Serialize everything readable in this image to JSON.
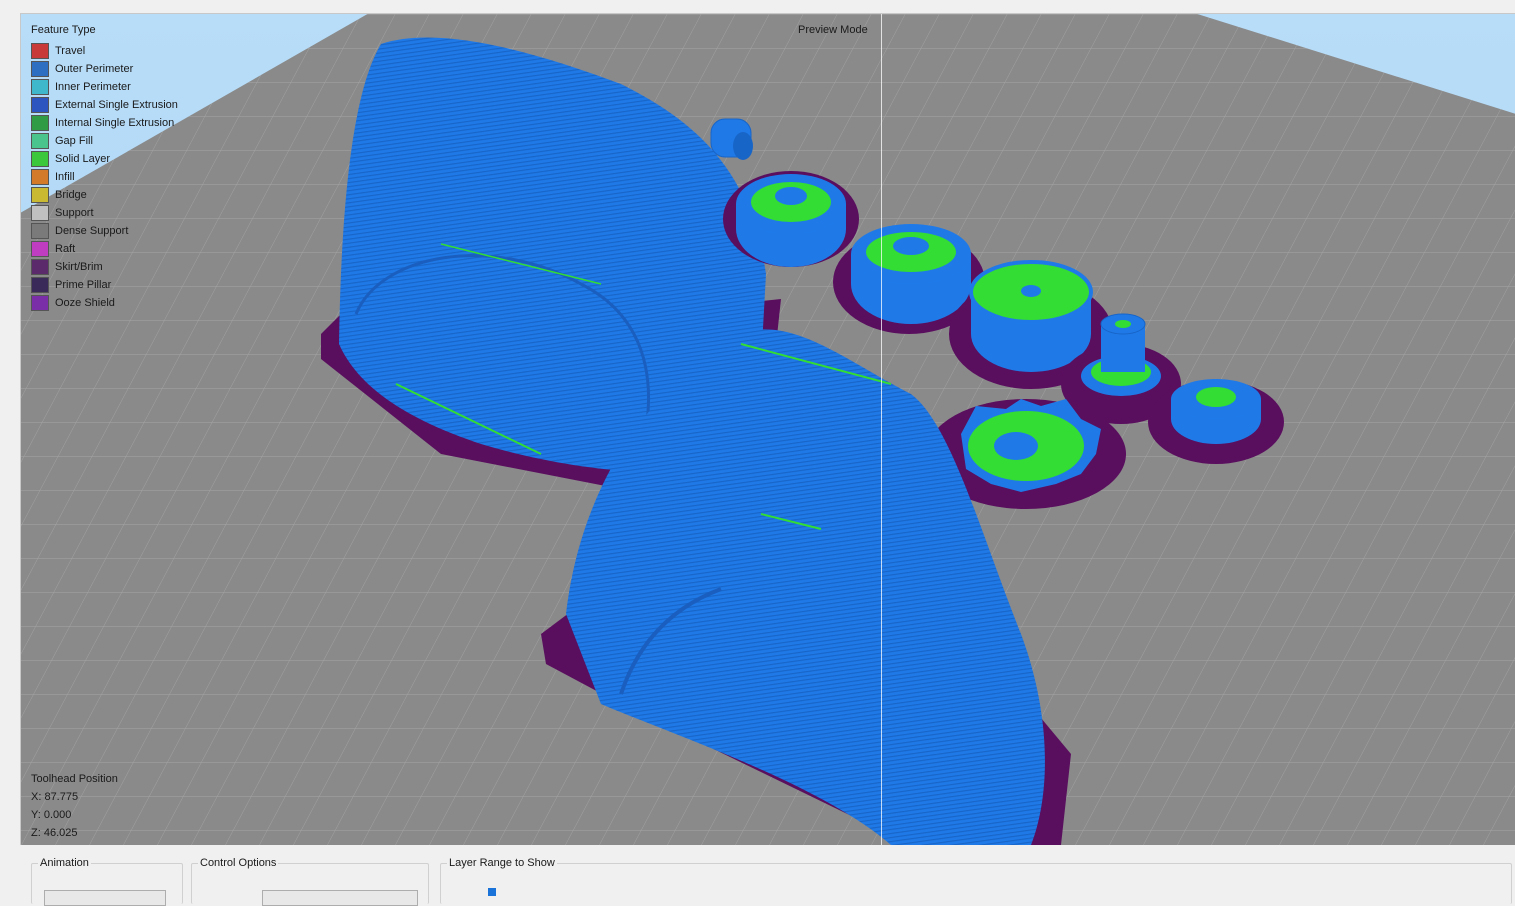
{
  "viewport": {
    "mode_label": "Preview Mode",
    "legend": {
      "title": "Feature Type",
      "items": [
        {
          "label": "Travel",
          "color": "#c83a3a"
        },
        {
          "label": "Outer Perimeter",
          "color": "#2f6fc2"
        },
        {
          "label": "Inner Perimeter",
          "color": "#3fb8cc"
        },
        {
          "label": "External Single Extrusion",
          "color": "#2d55c0"
        },
        {
          "label": "Internal Single Extrusion",
          "color": "#2f9c45"
        },
        {
          "label": "Gap Fill",
          "color": "#48c48c"
        },
        {
          "label": "Solid Layer",
          "color": "#3cc83c"
        },
        {
          "label": "Infill",
          "color": "#d27a2a"
        },
        {
          "label": "Bridge",
          "color": "#c8b832"
        },
        {
          "label": "Support",
          "color": "#c0c0c0"
        },
        {
          "label": "Dense Support",
          "color": "#7a7a7a"
        },
        {
          "label": "Raft",
          "color": "#c03cc0"
        },
        {
          "label": "Skirt/Brim",
          "color": "#5a2a6a"
        },
        {
          "label": "Prime Pillar",
          "color": "#3a2a5a"
        },
        {
          "label": "Ooze Shield",
          "color": "#7a2fa8"
        }
      ]
    },
    "toolhead": {
      "title": "Toolhead Position",
      "x": "X: 87.775",
      "y": "Y: 0.000",
      "z": "Z: 46.025"
    }
  },
  "controls": {
    "animation_label": "Animation",
    "control_options_label": "Control Options",
    "layer_range_label": "Layer Range to Show"
  },
  "colors": {
    "sky": "#aad4f5",
    "bed": "#8f8f8f",
    "grid": "#a9a9a9",
    "part_blue": "#1c78e6",
    "solid_green": "#33dd33",
    "brim_purple": "#5a0e5e"
  }
}
